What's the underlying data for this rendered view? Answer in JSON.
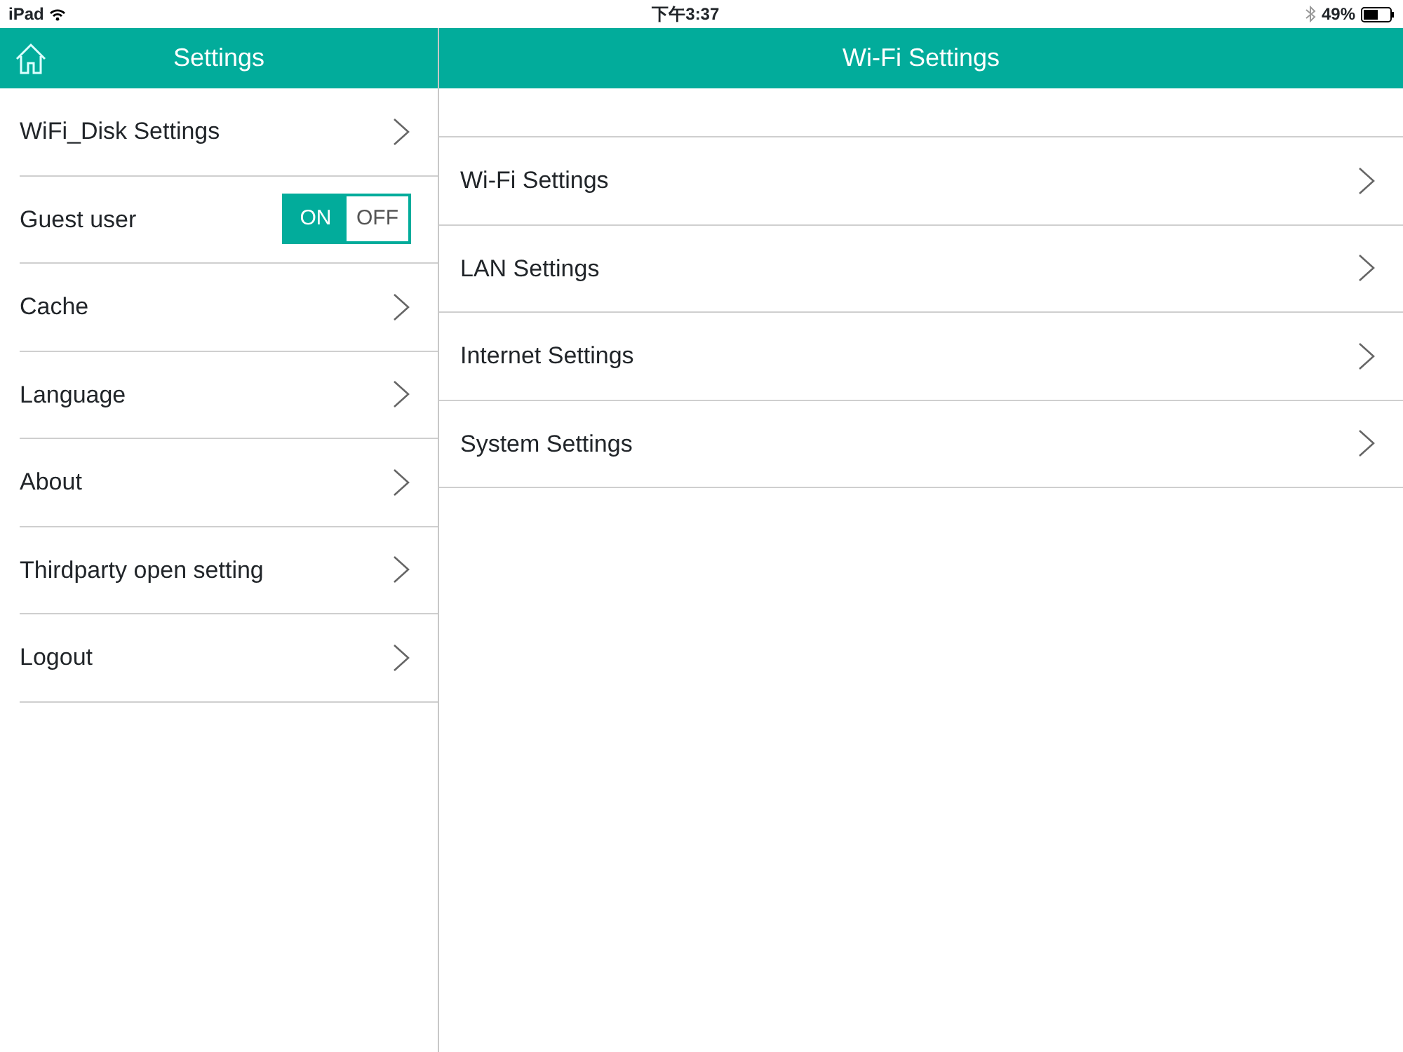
{
  "status_bar": {
    "device": "iPad",
    "time": "下午3:37",
    "battery": "49%"
  },
  "sidebar": {
    "title": "Settings",
    "items": [
      {
        "kind": "link",
        "label": "WiFi_Disk Settings"
      },
      {
        "kind": "toggle",
        "label": "Guest user",
        "on": true,
        "on_label": "ON",
        "off_label": "OFF"
      },
      {
        "kind": "link",
        "label": "Cache"
      },
      {
        "kind": "link",
        "label": "Language"
      },
      {
        "kind": "link",
        "label": "About"
      },
      {
        "kind": "link",
        "label": "Thirdparty open setting"
      },
      {
        "kind": "link",
        "label": "Logout"
      }
    ]
  },
  "detail": {
    "title": "Wi-Fi Settings",
    "items": [
      {
        "label": "Wi-Fi Settings"
      },
      {
        "label": "LAN Settings"
      },
      {
        "label": "Internet Settings"
      },
      {
        "label": "System Settings"
      }
    ]
  }
}
